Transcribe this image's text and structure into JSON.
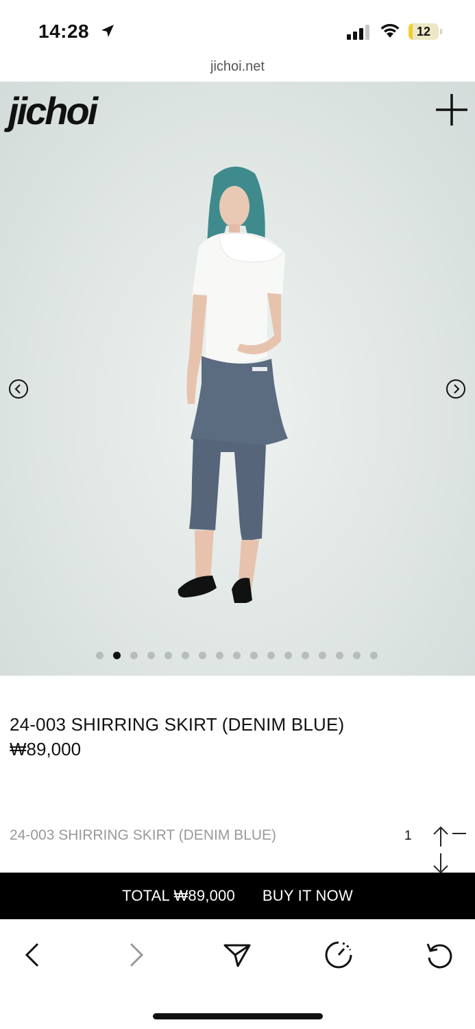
{
  "status_bar": {
    "time": "14:28",
    "battery": "12"
  },
  "browser": {
    "url": "jichoi.net"
  },
  "hero": {
    "logo": "jichoi",
    "slide_count": 17,
    "active_slide": 2
  },
  "product": {
    "title": "24-003 SHIRRING SKIRT (DENIM BLUE)",
    "price": "₩89,000"
  },
  "option": {
    "name": "24-003 SHIRRING SKIRT (DENIM BLUE)",
    "quantity": "1"
  },
  "buy_bar": {
    "total": "TOTAL ₩89,000",
    "buy_now": "BUY IT NOW"
  },
  "colors": {
    "background": "#ffffff",
    "buy_bar": "#000000",
    "hero_bg": "#dfe6e4",
    "battery_fill": "#f2cd2d"
  },
  "icons": [
    "location-arrow-icon",
    "signal-icon",
    "wifi-icon",
    "plus-icon",
    "arrow-left-circle-icon",
    "arrow-right-circle-icon",
    "back-icon",
    "forward-icon",
    "share-send-icon",
    "speed-icon",
    "reload-icon"
  ]
}
